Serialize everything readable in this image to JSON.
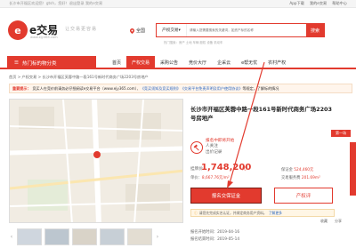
{
  "topbar": {
    "left": "长沙市开福区欢迎您！gtsh，您好！退出登录 我的e交易",
    "links": [
      "App下载",
      "我的e交易",
      "帮助中心"
    ]
  },
  "header": {
    "logo_glyph": "e",
    "logo_text": "e交易",
    "slogan": "让交易更容易",
    "domain": "www.ejy365.com",
    "location": "全国",
    "search_category": "产权交易",
    "search_placeholder": "请输入您需要搜索的关键词，如资产标的名称",
    "search_button": "搜索",
    "hot": "热门搜索：房产 土地 车辆 股权 设备 机动车"
  },
  "nav": {
    "category": "热门标的物分类",
    "items": [
      "首页",
      "产权交易",
      "采购公告",
      "竞价大厅",
      "企采云",
      "e帮无忧",
      "农村产权"
    ],
    "active_index": 1
  },
  "breadcrumb": "首页 > 产权交易 > 长沙市开福区芙蓉中路一段161号新时代商务广场2203号房地产",
  "notice": {
    "label": "重要提示：",
    "text": "竞买人在竞价前请务必仔细阅读e交易平台（www.ejy365.com）、",
    "link1": "《竞买须知及竞买规则》",
    "link2": "《交易平台免责声明及用户使用协议》",
    "tail": "等规定，了解标的情况"
  },
  "title": "长沙市开福区芙蓉中路一段161号新时代商务广场2203号房地产",
  "tag": "第一场",
  "status": {
    "line1": "报名中即将开始",
    "line2": "人关注",
    "line3": "出价记录"
  },
  "price": {
    "label": "挂牌价",
    "value": "1,748,200",
    "unit": "元",
    "avg_label": "单价：",
    "avg_value": "8,667.76元/m²",
    "deposit_label": "保证金",
    "deposit_value": "524,460元",
    "commission_label": "交易服务费",
    "commission_value": "201.69m²"
  },
  "buttons": {
    "primary": "报名交保证金",
    "secondary": "产权评"
  },
  "reminder": {
    "text": "请您先完成实名认证，并绑定商务用户资料。",
    "link": "了解更多"
  },
  "dates": {
    "start_label": "报名开始时间：",
    "start": "2019-04-16",
    "end_label": "报名结束时间：",
    "end": "2019-05-14"
  },
  "tools": [
    "收藏",
    "分享"
  ],
  "colors": {
    "accent": "#e23a2e",
    "link": "#2a66c0"
  }
}
